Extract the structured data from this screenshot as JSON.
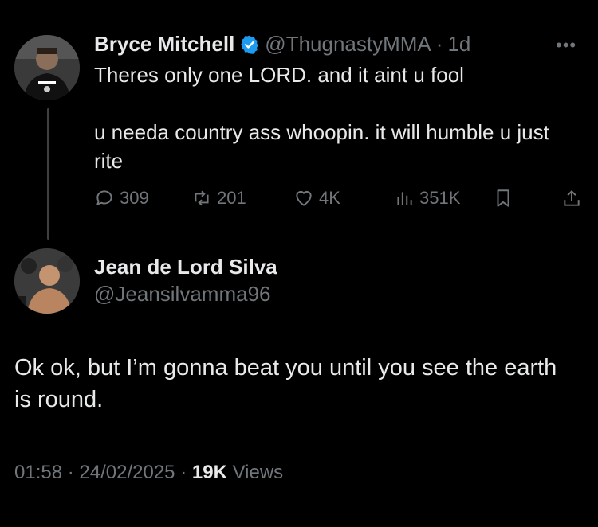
{
  "parent_tweet": {
    "author_name": "Bryce Mitchell",
    "handle": "@ThugnastyMMA",
    "separator": "·",
    "time": "1d",
    "more_label": "•••",
    "text_line1": "Theres only one LORD. and it aint u fool",
    "text_line2": "u needa country ass whoopin. it will humble u just rite",
    "replies": "309",
    "reposts": "201",
    "likes": "4K",
    "views": "351K",
    "verified_color": "#1d9bf0"
  },
  "reply_tweet": {
    "author_name": "Jean de Lord Silva",
    "handle": "@Jeansilvamma96",
    "text": "Ok ok, but I’m gonna beat you until you see the earth is round.",
    "time": "01:58",
    "date": "24/02/2025",
    "separator": "·",
    "views_count": "19K",
    "views_label": "Views"
  }
}
